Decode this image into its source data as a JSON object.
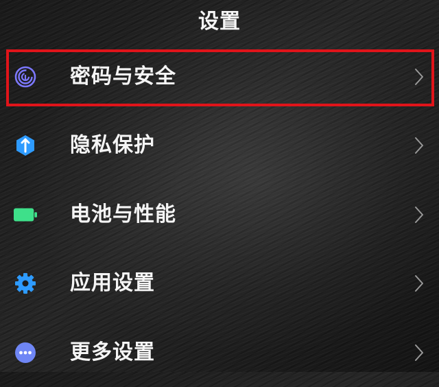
{
  "header": {
    "title": "设置"
  },
  "items": [
    {
      "label": "密码与安全",
      "icon": "fingerprint-icon",
      "icon_color": "#7c78ff"
    },
    {
      "label": "隐私保护",
      "icon": "privacy-shield-icon",
      "icon_color": "#2e9bff"
    },
    {
      "label": "电池与性能",
      "icon": "battery-icon",
      "icon_color": "#3ee08a"
    },
    {
      "label": "应用设置",
      "icon": "gear-icon",
      "icon_color": "#2e9bff"
    },
    {
      "label": "更多设置",
      "icon": "more-icon",
      "icon_color": "#6f86f5"
    }
  ],
  "highlight_color": "#e0141a",
  "chevron_icon": "chevron-right-icon"
}
